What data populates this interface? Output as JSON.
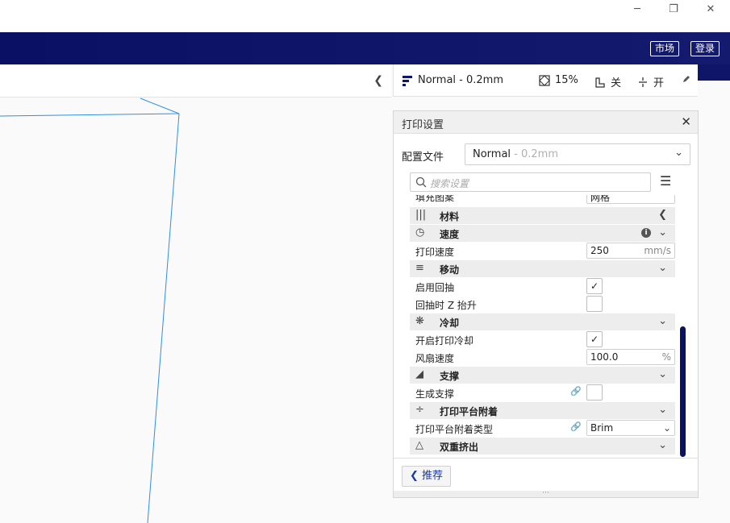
{
  "window": {
    "minimize": "─",
    "maximize": "❐",
    "close": "✕"
  },
  "header": {
    "marketplace_label": "市场",
    "login_label": "登录"
  },
  "print_bar": {
    "profile": "Normal - 0.2mm",
    "infill": "15%",
    "support": "关",
    "adhesion": "开"
  },
  "settings_panel": {
    "title": "打印设置",
    "profile_label": "配置文件",
    "profile_name": "Normal",
    "profile_suffix": " - 0.2mm",
    "search_placeholder": "搜索设置",
    "partial_row_label": "填充图案",
    "partial_row_value": "网格",
    "categories": {
      "material": "材料",
      "speed": "速度",
      "travel": "移动",
      "cooling": "冷却",
      "support": "支撑",
      "adhesion": "打印平台附着",
      "dual": "双重挤出"
    },
    "settings": {
      "print_speed_label": "打印速度",
      "print_speed_value": "250",
      "print_speed_unit": "mm/s",
      "retraction_label": "启用回抽",
      "retraction_checked": true,
      "z_hop_label": "回抽时 Z 抬升",
      "z_hop_checked": false,
      "cooling_label": "开启打印冷却",
      "cooling_checked": true,
      "fan_speed_label": "风扇速度",
      "fan_speed_value": "100.0",
      "fan_speed_unit": "%",
      "gen_support_label": "生成支撑",
      "gen_support_checked": false,
      "adhesion_type_label": "打印平台附着类型",
      "adhesion_type_value": "Brim"
    },
    "recommended_label": "推荐",
    "check_mark": "✓"
  },
  "colors": {
    "header_bg": "#0a1064",
    "scrollbar": "#0c1262",
    "model_outline": "#2f8fdf",
    "link_blue": "#1c3a9e"
  }
}
